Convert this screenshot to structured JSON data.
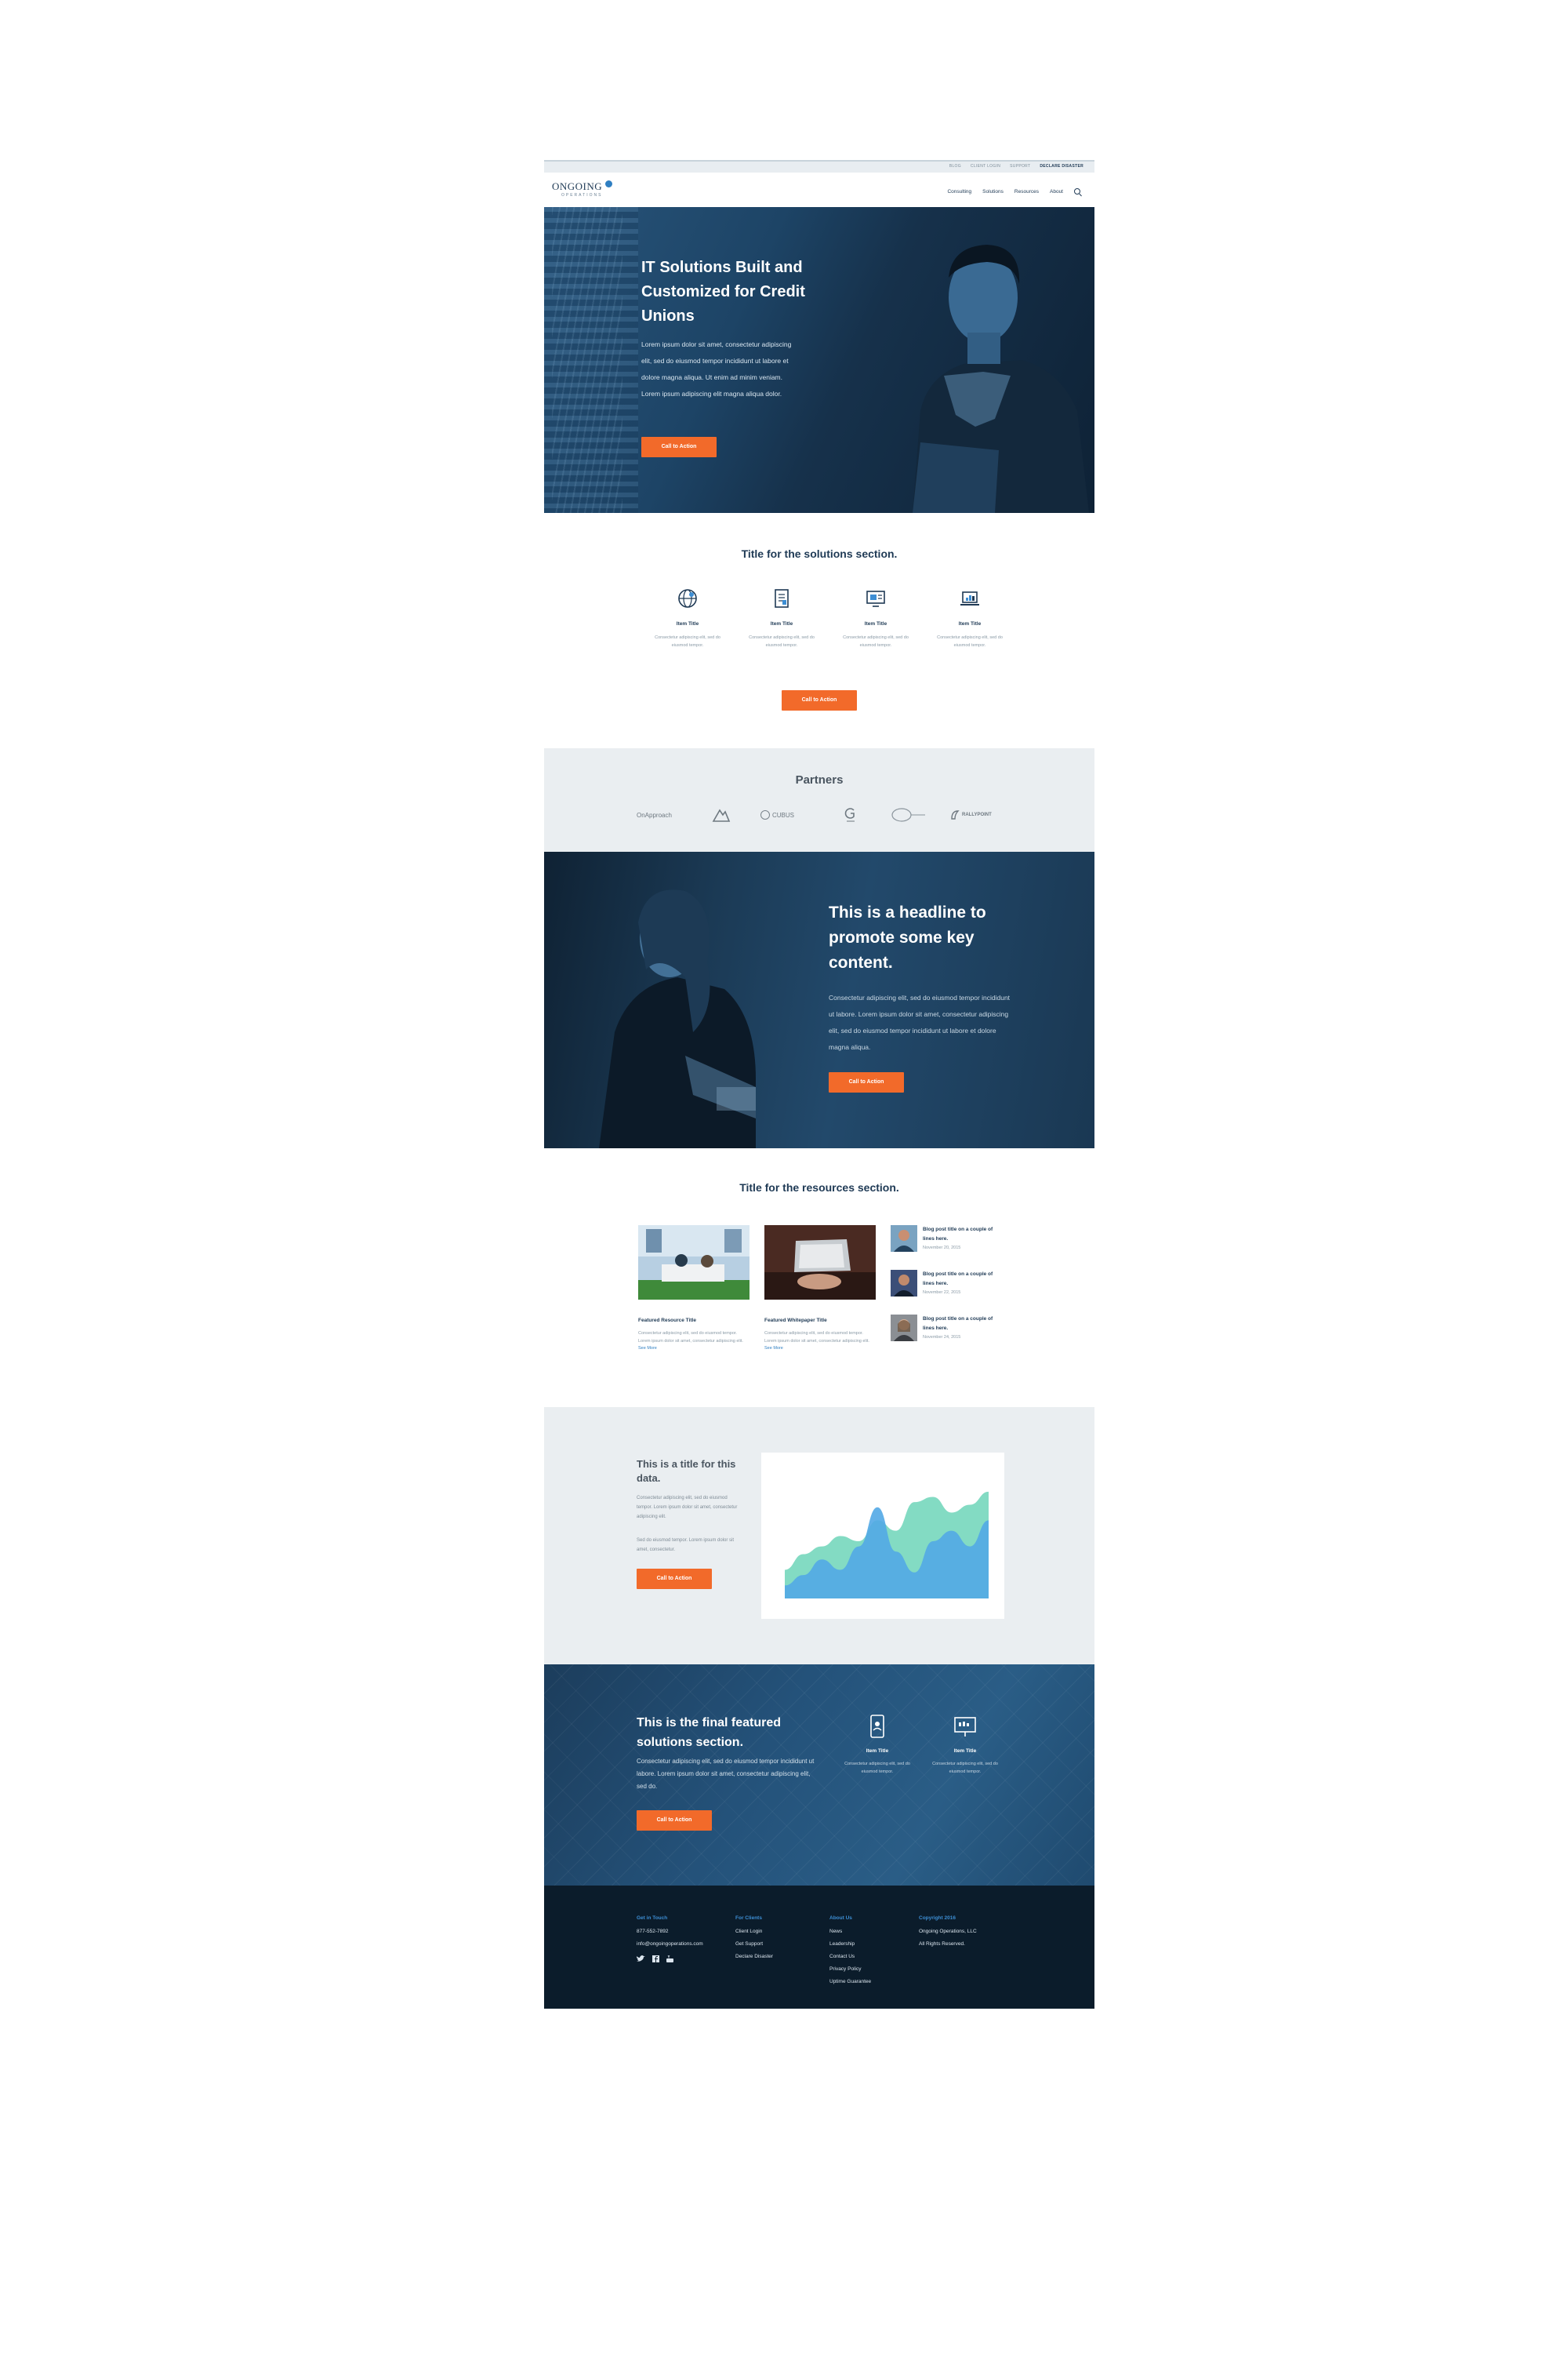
{
  "colors": {
    "accent": "#f26a2a",
    "navy": "#1f3a55",
    "footer_bg": "#0b1c2b",
    "link": "#2f7fc2",
    "light_bg": "#eaeef1"
  },
  "utility": {
    "links": [
      "BLOG",
      "CLIENT LOGIN",
      "SUPPORT",
      "DECLARE DISASTER"
    ]
  },
  "brand": {
    "name": "ONGOING",
    "sub": "OPERATIONS"
  },
  "nav": {
    "items": [
      "Consulting",
      "Solutions",
      "Resources",
      "About"
    ],
    "search_icon": "search-icon"
  },
  "hero": {
    "title": "IT Solutions Built and Customized for Credit Unions",
    "body": "Lorem ipsum dolor sit amet, consectetur adipiscing elit, sed do eiusmod tempor incididunt ut labore et dolore magna aliqua. Ut enim ad minim veniam. Lorem ipsum adipiscing elit magna aliqua dolor.",
    "cta": "Call to Action"
  },
  "solutions": {
    "title": "Title for the solutions section.",
    "items": [
      {
        "icon": "globe-icon",
        "title": "Item Title",
        "desc": "Consectetur adipiscing elit, sed do eiusmod tempor."
      },
      {
        "icon": "document-icon",
        "title": "Item Title",
        "desc": "Consectetur adipiscing elit, sed do eiusmod tempor."
      },
      {
        "icon": "monitor-icon",
        "title": "Item Title",
        "desc": "Consectetur adipiscing elit, sed do eiusmod tempor."
      },
      {
        "icon": "laptop-chart-icon",
        "title": "Item Title",
        "desc": "Consectetur adipiscing elit, sed do eiusmod tempor."
      }
    ],
    "cta": "Call to Action"
  },
  "partners": {
    "title": "Partners",
    "logos": [
      "OnApproach",
      "",
      "CUBUS",
      "",
      "",
      "RALLYPOINT"
    ]
  },
  "promo": {
    "title": "This is a headline to promote some key content.",
    "body": "Consectetur adipiscing elit, sed do eiusmod tempor incididunt ut labore. Lorem ipsum dolor sit amet, consectetur adipiscing elit, sed do eiusmod tempor incididunt ut labore et dolore magna aliqua.",
    "cta": "Call to Action"
  },
  "resources": {
    "title": "Title for the resources section.",
    "cards": [
      {
        "title": "Featured Resource Title",
        "desc": "Consectetur adipiscing elit, sed do eiusmod tempor. Lorem ipsum dolor sit amet, consectetur adipiscing elit.",
        "more": "See More"
      },
      {
        "title": "Featured Whitepaper Title",
        "desc": "Consectetur adipiscing elit, sed do eiusmod tempor. Lorem ipsum dolor sit amet, consectetur adipiscing elit.",
        "more": "See More"
      }
    ],
    "posts": [
      {
        "title": "Blog post title on a couple of lines here.",
        "date": "November 20, 2015"
      },
      {
        "title": "Blog post title on a couple of lines here.",
        "date": "November 22, 2015"
      },
      {
        "title": "Blog post title on a couple of lines here.",
        "date": "November 24, 2015"
      }
    ]
  },
  "data_section": {
    "title": "This is a title for this data.",
    "p1": "Consectetur adipiscing elit, sed do eiusmod tempor. Lorem ipsum dolor sit amet, consectetur adipiscing elit.",
    "p2": "Sed do eiusmod tempor. Lorem ipsum dolor sit amet, consectetur.",
    "cta": "Call to Action"
  },
  "chart_data": {
    "type": "area",
    "title": "",
    "xlabel": "",
    "ylabel": "",
    "x": [
      "",
      "",
      "",
      "",
      "",
      "",
      "",
      "",
      "",
      "",
      "",
      ""
    ],
    "y_ticks": [
      "",
      "",
      "",
      "",
      "",
      "",
      "",
      ""
    ],
    "ylim": [
      0,
      100
    ],
    "grid": false,
    "legend": "none",
    "series": [
      {
        "color": "#7cd9c0",
        "values": [
          22,
          34,
          40,
          48,
          44,
          60,
          52,
          74,
          78,
          66,
          72,
          82
        ]
      },
      {
        "color": "#52a9e6",
        "values": [
          10,
          18,
          30,
          22,
          40,
          70,
          36,
          20,
          44,
          52,
          40,
          60
        ]
      }
    ]
  },
  "final": {
    "title": "This is the final featured solutions section.",
    "body": "Consectetur adipiscing elit, sed do eiusmod tempor incididunt ut labore. Lorem ipsum dolor sit amet, consectetur adipiscing elit, sed do.",
    "cta": "Call to Action",
    "items": [
      {
        "icon": "mobile-icon",
        "title": "Item Title",
        "desc": "Consectetur adipiscing elit, sed do eiusmod tempor."
      },
      {
        "icon": "presentation-icon",
        "title": "Item Title",
        "desc": "Consectetur adipiscing elit, sed do eiusmod tempor."
      }
    ]
  },
  "footer": {
    "contact": {
      "heading": "Get in Touch",
      "lines": [
        "877-552-7892",
        "info@ongoingoperations.com"
      ],
      "social": [
        "twitter-icon",
        "facebook-icon",
        "youtube-icon"
      ]
    },
    "clients": {
      "heading": "For Clients",
      "links": [
        "Client Login",
        "Get Support",
        "Declare Disaster"
      ]
    },
    "about": {
      "heading": "About Us",
      "links": [
        "News",
        "Leadership",
        "Contact Us",
        "Privacy Policy",
        "Uptime Guarantee"
      ]
    },
    "copyright": {
      "heading": "Copyright 2016",
      "lines": [
        "Ongoing Operations, LLC",
        "All Rights Reserved."
      ]
    }
  }
}
